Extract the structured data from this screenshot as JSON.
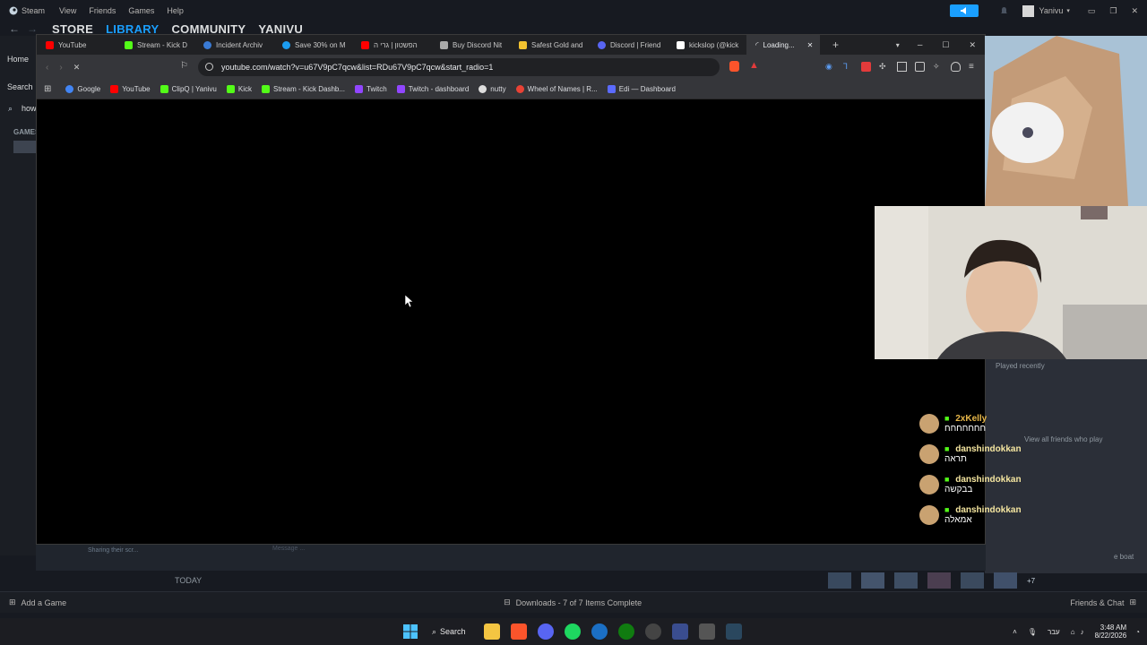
{
  "steam": {
    "logo_text": "Steam",
    "menu": [
      "View",
      "Friends",
      "Games",
      "Help"
    ],
    "nav": {
      "store": "STORE",
      "library": "LIBRARY",
      "community": "COMMUNITY",
      "user": "YANIVU"
    },
    "user_menu": "Yanivu",
    "sidebar": {
      "home": "Home",
      "search": "Search",
      "search_value": "how",
      "games_header": "GAMES"
    },
    "recently_played": "Played recently",
    "view_all_friends": "View all friends who play",
    "boat_text": "e boat",
    "extra_count": "+7",
    "strip_status": "Sharing their scr...",
    "message_placeholder": "Message ...",
    "today_label": "TODAY",
    "add_game": "Add a Game",
    "downloads": "Downloads - 7 of 7 Items Complete",
    "friends_chat": "Friends & Chat"
  },
  "browser": {
    "tabs": [
      {
        "label": "YouTube",
        "color": "#ff0000"
      },
      {
        "label": "Stream - Kick D",
        "color": "#53fc18"
      },
      {
        "label": "Incident Archiv",
        "color": "#3a7bd5"
      },
      {
        "label": "Save 30% on M",
        "color": "#1b9cf0"
      },
      {
        "label": "הפשטון | גרי ה",
        "color": "#ff0000"
      },
      {
        "label": "Buy Discord Nit",
        "color": "#aaaaaa"
      },
      {
        "label": "Safest Gold and",
        "color": "#f2c230"
      },
      {
        "label": "Discord | Friend",
        "color": "#5865f2"
      },
      {
        "label": "kickslop (@kick",
        "color": "#ffffff"
      },
      {
        "label": "Loading...",
        "color": "#aaaaaa",
        "active": true
      }
    ],
    "url": "youtube.com/watch?v=u67V9pC7qcw&list=RDu67V9pC7qcw&start_radio=1",
    "bookmarks": [
      {
        "label": "Google",
        "color": "#4285f4"
      },
      {
        "label": "YouTube",
        "color": "#ff0000"
      },
      {
        "label": "ClipQ | Yanivu",
        "color": "#53fc18"
      },
      {
        "label": "Kick",
        "color": "#53fc18"
      },
      {
        "label": "Stream - Kick Dashb...",
        "color": "#53fc18"
      },
      {
        "label": "Twitch",
        "color": "#9146ff"
      },
      {
        "label": "Twitch - dashboard",
        "color": "#9146ff"
      },
      {
        "label": "nutty",
        "color": "#dddddd"
      },
      {
        "label": "Wheel of Names | R...",
        "color": "#e94235"
      },
      {
        "label": "Edi — Dashboard",
        "color": "#5b6bff"
      }
    ]
  },
  "chat": [
    {
      "user": "2xKelly",
      "message": "חחחחחחח"
    },
    {
      "user": "danshindokkan",
      "message": "תראה"
    },
    {
      "user": "danshindokkan",
      "message": "בבקשה"
    },
    {
      "user": "danshindokkan",
      "message": "אמאלה"
    }
  ],
  "taskbar": {
    "search": "Search",
    "lang": "עבר",
    "time": "3:48 AM",
    "date": "8/22/2026"
  }
}
